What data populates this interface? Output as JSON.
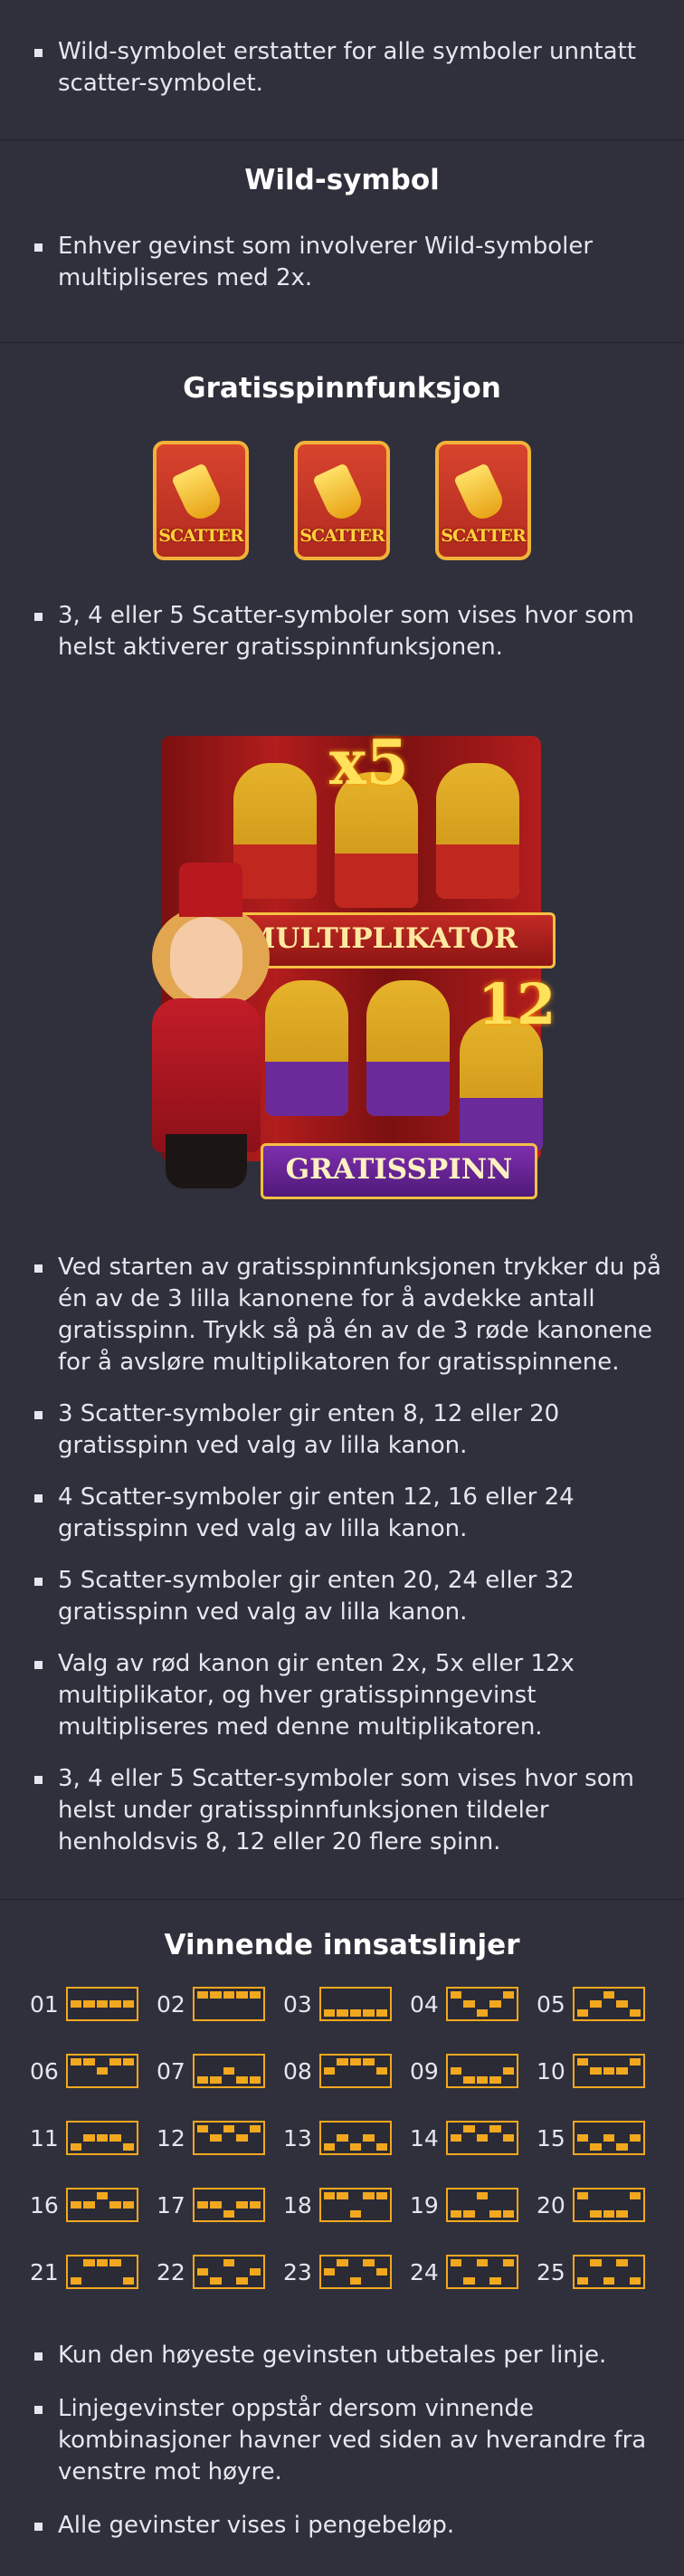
{
  "sections": {
    "wild_intro": {
      "bullets": [
        "Wild-symbolet erstatter for alle symboler unntatt scatter-symbolet."
      ]
    },
    "wild_symbol": {
      "title": "Wild-symbol",
      "bullets": [
        "Enhver gevinst som involverer Wild-symboler multipliseres med 2x."
      ]
    },
    "free_spins": {
      "title": "Gratisspinnfunksjon",
      "scatter_label": "SCATTER",
      "scatter_count": 3,
      "bullets_top": [
        "3, 4 eller 5 Scatter-symboler som vises hvor som helst aktiverer gratisspinnfunksjonen."
      ],
      "promo": {
        "multiplier_text": "x5",
        "multiplier_banner": "MULTIPLIKATOR",
        "spins_number": "12",
        "spins_banner": "GRATISSPINN"
      },
      "bullets": [
        "Ved starten av gratisspinnfunksjonen trykker du på én av de 3 lilla kanonene for å avdekke antall gratisspinn. Trykk så på én av de 3 røde kanonene for å avsløre multiplikatoren for gratisspinnene.",
        "3 Scatter-symboler gir enten 8, 12 eller 20 gratisspinn ved valg av lilla kanon.",
        "4 Scatter-symboler gir enten 12, 16 eller 24 gratisspinn ved valg av lilla kanon.",
        "5 Scatter-symboler gir enten 20, 24 eller 32 gratisspinn ved valg av lilla kanon.",
        "Valg av rød kanon gir enten 2x, 5x eller 12x multiplikator, og hver gratisspinngevinst multipliseres med denne multiplikatoren.",
        "3, 4 eller 5 Scatter-symboler som vises hvor som helst under gratisspinnfunksjonen tildeler henholdsvis 8, 12 eller 20 flere spinn."
      ]
    },
    "paylines": {
      "title": "Vinnende innsatslinjer",
      "lines": [
        {
          "num": "01",
          "rows": [
            1,
            1,
            1,
            1,
            1
          ]
        },
        {
          "num": "02",
          "rows": [
            0,
            0,
            0,
            0,
            0
          ]
        },
        {
          "num": "03",
          "rows": [
            2,
            2,
            2,
            2,
            2
          ]
        },
        {
          "num": "04",
          "rows": [
            0,
            1,
            2,
            1,
            0
          ]
        },
        {
          "num": "05",
          "rows": [
            2,
            1,
            0,
            1,
            2
          ]
        },
        {
          "num": "06",
          "rows": [
            0,
            0,
            1,
            0,
            0
          ]
        },
        {
          "num": "07",
          "rows": [
            2,
            2,
            1,
            2,
            2
          ]
        },
        {
          "num": "08",
          "rows": [
            1,
            0,
            0,
            0,
            1
          ]
        },
        {
          "num": "09",
          "rows": [
            1,
            2,
            2,
            2,
            1
          ]
        },
        {
          "num": "10",
          "rows": [
            0,
            1,
            1,
            1,
            0
          ]
        },
        {
          "num": "11",
          "rows": [
            2,
            1,
            1,
            1,
            2
          ]
        },
        {
          "num": "12",
          "rows": [
            0,
            1,
            0,
            1,
            0
          ]
        },
        {
          "num": "13",
          "rows": [
            2,
            1,
            2,
            1,
            2
          ]
        },
        {
          "num": "14",
          "rows": [
            1,
            0,
            1,
            0,
            1
          ]
        },
        {
          "num": "15",
          "rows": [
            1,
            2,
            1,
            2,
            1
          ]
        },
        {
          "num": "16",
          "rows": [
            1,
            1,
            0,
            1,
            1
          ]
        },
        {
          "num": "17",
          "rows": [
            1,
            1,
            2,
            1,
            1
          ]
        },
        {
          "num": "18",
          "rows": [
            0,
            0,
            2,
            0,
            0
          ]
        },
        {
          "num": "19",
          "rows": [
            2,
            2,
            0,
            2,
            2
          ]
        },
        {
          "num": "20",
          "rows": [
            0,
            2,
            2,
            2,
            0
          ]
        },
        {
          "num": "21",
          "rows": [
            2,
            0,
            0,
            0,
            2
          ]
        },
        {
          "num": "22",
          "rows": [
            1,
            2,
            0,
            2,
            1
          ]
        },
        {
          "num": "23",
          "rows": [
            1,
            0,
            2,
            0,
            1
          ]
        },
        {
          "num": "24",
          "rows": [
            0,
            2,
            0,
            2,
            0
          ]
        },
        {
          "num": "25",
          "rows": [
            2,
            0,
            2,
            0,
            2
          ]
        }
      ],
      "bullets": [
        "Kun den høyeste gevinsten utbetales per linje.",
        "Linjegevinster oppstår dersom vinnende kombinasjoner havner ved siden av hverandre fra venstre mot høyre.",
        "Alle gevinster vises i pengebeløp."
      ]
    }
  },
  "colors": {
    "background": "#30303c",
    "accent": "#f2a81e"
  }
}
